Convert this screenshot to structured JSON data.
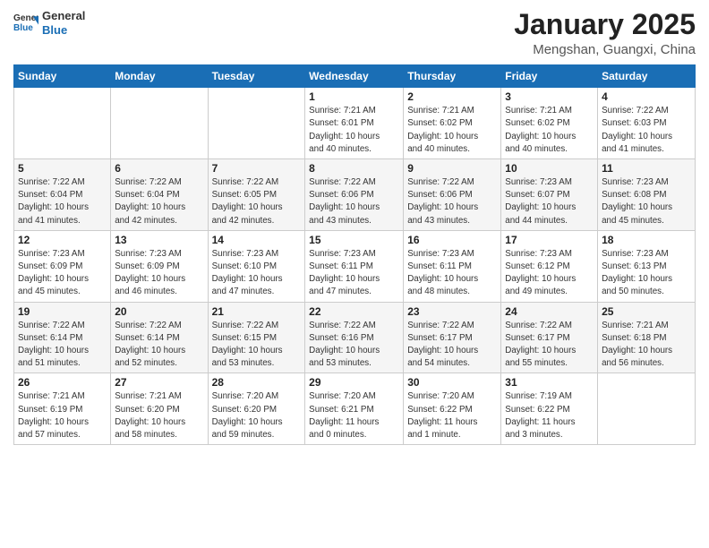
{
  "logo": {
    "line1": "General",
    "line2": "Blue"
  },
  "title": "January 2025",
  "subtitle": "Mengshan, Guangxi, China",
  "weekdays": [
    "Sunday",
    "Monday",
    "Tuesday",
    "Wednesday",
    "Thursday",
    "Friday",
    "Saturday"
  ],
  "weeks": [
    [
      {
        "day": "",
        "info": ""
      },
      {
        "day": "",
        "info": ""
      },
      {
        "day": "",
        "info": ""
      },
      {
        "day": "1",
        "info": "Sunrise: 7:21 AM\nSunset: 6:01 PM\nDaylight: 10 hours\nand 40 minutes."
      },
      {
        "day": "2",
        "info": "Sunrise: 7:21 AM\nSunset: 6:02 PM\nDaylight: 10 hours\nand 40 minutes."
      },
      {
        "day": "3",
        "info": "Sunrise: 7:21 AM\nSunset: 6:02 PM\nDaylight: 10 hours\nand 40 minutes."
      },
      {
        "day": "4",
        "info": "Sunrise: 7:22 AM\nSunset: 6:03 PM\nDaylight: 10 hours\nand 41 minutes."
      }
    ],
    [
      {
        "day": "5",
        "info": "Sunrise: 7:22 AM\nSunset: 6:04 PM\nDaylight: 10 hours\nand 41 minutes."
      },
      {
        "day": "6",
        "info": "Sunrise: 7:22 AM\nSunset: 6:04 PM\nDaylight: 10 hours\nand 42 minutes."
      },
      {
        "day": "7",
        "info": "Sunrise: 7:22 AM\nSunset: 6:05 PM\nDaylight: 10 hours\nand 42 minutes."
      },
      {
        "day": "8",
        "info": "Sunrise: 7:22 AM\nSunset: 6:06 PM\nDaylight: 10 hours\nand 43 minutes."
      },
      {
        "day": "9",
        "info": "Sunrise: 7:22 AM\nSunset: 6:06 PM\nDaylight: 10 hours\nand 43 minutes."
      },
      {
        "day": "10",
        "info": "Sunrise: 7:23 AM\nSunset: 6:07 PM\nDaylight: 10 hours\nand 44 minutes."
      },
      {
        "day": "11",
        "info": "Sunrise: 7:23 AM\nSunset: 6:08 PM\nDaylight: 10 hours\nand 45 minutes."
      }
    ],
    [
      {
        "day": "12",
        "info": "Sunrise: 7:23 AM\nSunset: 6:09 PM\nDaylight: 10 hours\nand 45 minutes."
      },
      {
        "day": "13",
        "info": "Sunrise: 7:23 AM\nSunset: 6:09 PM\nDaylight: 10 hours\nand 46 minutes."
      },
      {
        "day": "14",
        "info": "Sunrise: 7:23 AM\nSunset: 6:10 PM\nDaylight: 10 hours\nand 47 minutes."
      },
      {
        "day": "15",
        "info": "Sunrise: 7:23 AM\nSunset: 6:11 PM\nDaylight: 10 hours\nand 47 minutes."
      },
      {
        "day": "16",
        "info": "Sunrise: 7:23 AM\nSunset: 6:11 PM\nDaylight: 10 hours\nand 48 minutes."
      },
      {
        "day": "17",
        "info": "Sunrise: 7:23 AM\nSunset: 6:12 PM\nDaylight: 10 hours\nand 49 minutes."
      },
      {
        "day": "18",
        "info": "Sunrise: 7:23 AM\nSunset: 6:13 PM\nDaylight: 10 hours\nand 50 minutes."
      }
    ],
    [
      {
        "day": "19",
        "info": "Sunrise: 7:22 AM\nSunset: 6:14 PM\nDaylight: 10 hours\nand 51 minutes."
      },
      {
        "day": "20",
        "info": "Sunrise: 7:22 AM\nSunset: 6:14 PM\nDaylight: 10 hours\nand 52 minutes."
      },
      {
        "day": "21",
        "info": "Sunrise: 7:22 AM\nSunset: 6:15 PM\nDaylight: 10 hours\nand 53 minutes."
      },
      {
        "day": "22",
        "info": "Sunrise: 7:22 AM\nSunset: 6:16 PM\nDaylight: 10 hours\nand 53 minutes."
      },
      {
        "day": "23",
        "info": "Sunrise: 7:22 AM\nSunset: 6:17 PM\nDaylight: 10 hours\nand 54 minutes."
      },
      {
        "day": "24",
        "info": "Sunrise: 7:22 AM\nSunset: 6:17 PM\nDaylight: 10 hours\nand 55 minutes."
      },
      {
        "day": "25",
        "info": "Sunrise: 7:21 AM\nSunset: 6:18 PM\nDaylight: 10 hours\nand 56 minutes."
      }
    ],
    [
      {
        "day": "26",
        "info": "Sunrise: 7:21 AM\nSunset: 6:19 PM\nDaylight: 10 hours\nand 57 minutes."
      },
      {
        "day": "27",
        "info": "Sunrise: 7:21 AM\nSunset: 6:20 PM\nDaylight: 10 hours\nand 58 minutes."
      },
      {
        "day": "28",
        "info": "Sunrise: 7:20 AM\nSunset: 6:20 PM\nDaylight: 10 hours\nand 59 minutes."
      },
      {
        "day": "29",
        "info": "Sunrise: 7:20 AM\nSunset: 6:21 PM\nDaylight: 11 hours\nand 0 minutes."
      },
      {
        "day": "30",
        "info": "Sunrise: 7:20 AM\nSunset: 6:22 PM\nDaylight: 11 hours\nand 1 minute."
      },
      {
        "day": "31",
        "info": "Sunrise: 7:19 AM\nSunset: 6:22 PM\nDaylight: 11 hours\nand 3 minutes."
      },
      {
        "day": "",
        "info": ""
      }
    ]
  ]
}
